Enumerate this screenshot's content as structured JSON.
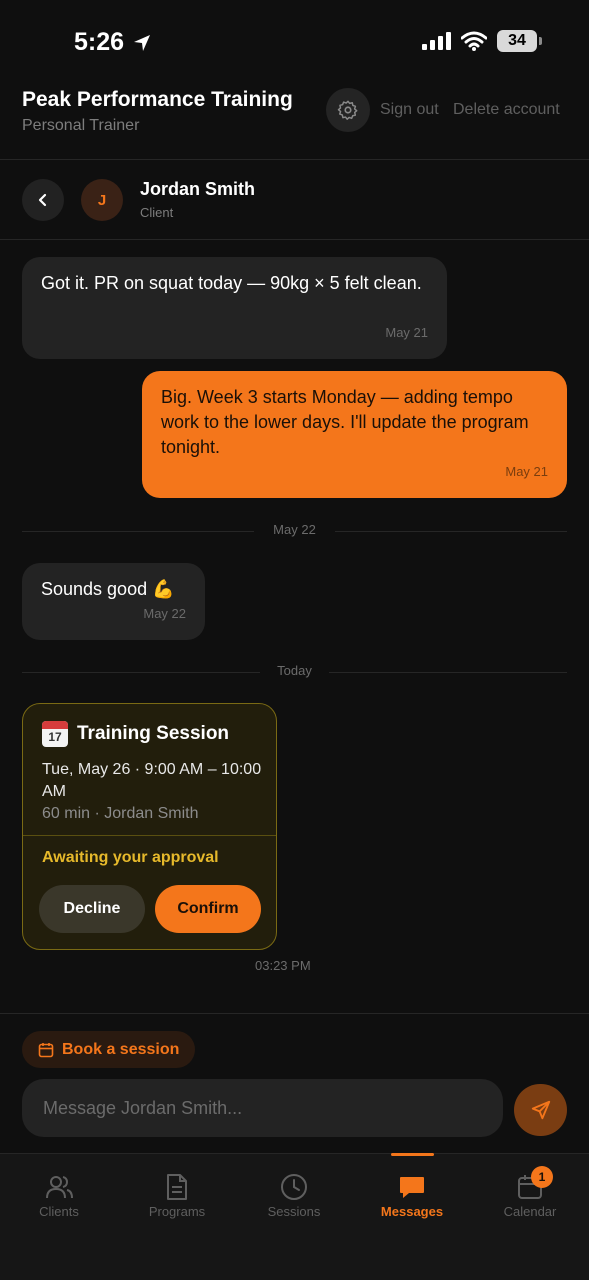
{
  "status_bar": {
    "time": "5:26",
    "battery": "34"
  },
  "header": {
    "title": "Peak Performance Training",
    "subtitle": "Personal Trainer",
    "sign_out": "Sign out",
    "delete_account": "Delete account"
  },
  "chat": {
    "avatar_initial": "J",
    "contact_name": "Jordan Smith",
    "contact_role": "Client"
  },
  "messages": [
    {
      "text": "Got it. PR on squat today — 90kg × 5 felt clean.",
      "time": "May 21",
      "direction": "in"
    },
    {
      "text": "Big. Week 3 starts Monday — adding tempo work to the lower days. I'll update the program tonight.",
      "time": "May 21",
      "direction": "out"
    },
    {
      "text": "Sounds good 💪",
      "time": "May 22",
      "direction": "in"
    }
  ],
  "separators": [
    "May 22",
    "Today"
  ],
  "session_card": {
    "emoji_day": "17",
    "title": "Training Session",
    "when": "Tue, May 26 · 9:00 AM – 10:00 AM",
    "meta": "60 min · Jordan Smith",
    "status": "Awaiting your approval",
    "decline": "Decline",
    "confirm": "Confirm",
    "time": "03:23 PM"
  },
  "composer": {
    "book_label": "Book a session",
    "placeholder": "Message Jordan Smith..."
  },
  "tabs": [
    {
      "label": "Clients",
      "icon": "users-icon"
    },
    {
      "label": "Programs",
      "icon": "document-icon"
    },
    {
      "label": "Sessions",
      "icon": "clock-icon"
    },
    {
      "label": "Messages",
      "icon": "chat-icon",
      "active": true
    },
    {
      "label": "Calendar",
      "icon": "calendar-icon",
      "badge": "1"
    }
  ],
  "colors": {
    "accent": "#f4761b",
    "background": "#0f0f0f",
    "bubble_in": "#232323",
    "approval": "#e6b92b"
  }
}
